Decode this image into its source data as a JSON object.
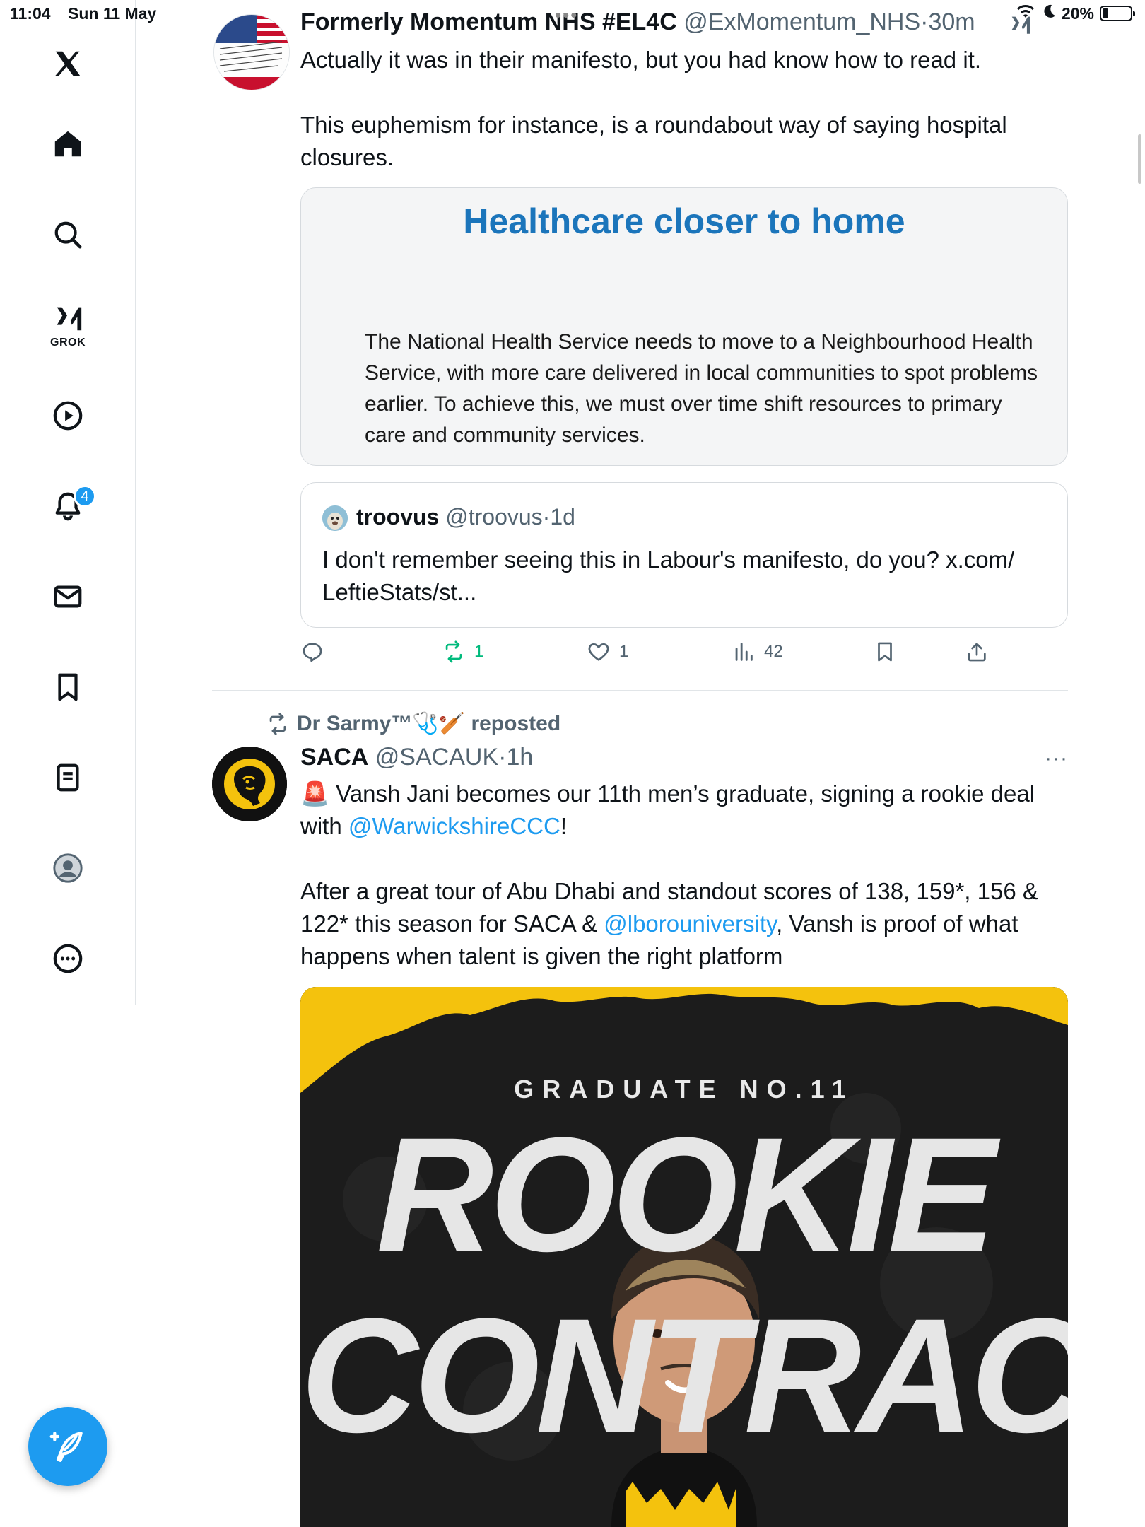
{
  "status_bar": {
    "time": "11:04",
    "date": "Sun 11 May",
    "battery_text": "20%",
    "battery_level": 0.2
  },
  "sidebar": {
    "items": [
      {
        "icon": "x-logo-icon"
      },
      {
        "icon": "home-icon"
      },
      {
        "icon": "search-icon"
      },
      {
        "icon": "grok-icon",
        "label": "GROK"
      },
      {
        "icon": "video-play-icon"
      },
      {
        "icon": "bell-icon",
        "badge": "4"
      },
      {
        "icon": "mail-icon"
      },
      {
        "icon": "bookmark-icon"
      },
      {
        "icon": "document-icon"
      },
      {
        "icon": "profile-avatar-icon"
      },
      {
        "icon": "more-circle-icon"
      }
    ],
    "compose_icon": "compose-feather-icon"
  },
  "tweet1": {
    "display_name": "Formerly Momentum NHS #EL4C",
    "handle": "@ExMomentum_NHS",
    "separator": "·",
    "time": "30m",
    "text_p1": "Actually it was in their manifesto, but you had know how to read it.",
    "text_p2": "This euphemism for instance, is a roundabout way of saying hospital closures.",
    "card": {
      "title": "Healthcare closer to home",
      "body": "The National Health Service needs to move to a Neighbourhood Health Service, with more care delivered in local communities to spot problems earlier. To achieve this, we must over time shift resources to primary care and community services."
    },
    "quote": {
      "display_name": "troovus",
      "handle": "@troovus",
      "separator": "·",
      "time": "1d",
      "text": "I don't remember seeing this in Labour's manifesto, do you? x.com/ LeftieStats/st..."
    },
    "actions": {
      "reply_count": "",
      "repost_count": "1",
      "like_count": "1",
      "views_count": "42"
    }
  },
  "tweet2": {
    "reposted_by": "Dr Sarmy™🩺🏏 reposted",
    "display_name": "SACA",
    "handle": "@SACAUK",
    "separator": "·",
    "time": "1h",
    "text_p1_emoji": "🚨",
    "text_p1_a": " Vansh Jani becomes our 11th men’s graduate, signing a rookie deal with ",
    "text_p1_link": "@WarwickshireCCC",
    "text_p1_b": "!",
    "text_p2_a": "After a great tour of Abu Dhabi and standout scores of 138, 159*, 156 & 122* this season for SACA & ",
    "text_p2_link": "@lborouniversity",
    "text_p2_b": ", Vansh is proof of what happens when talent is given the right platform",
    "media": {
      "subtitle": "GRADUATE NO.11",
      "line1": "ROOKIE",
      "line2": "CONTRACT"
    },
    "more_label": "···"
  },
  "colors": {
    "accent": "#1d9bf0",
    "repost_green": "#00ba7c",
    "card_title_blue": "#1b75bb",
    "saca_yellow": "#f4c20d"
  }
}
